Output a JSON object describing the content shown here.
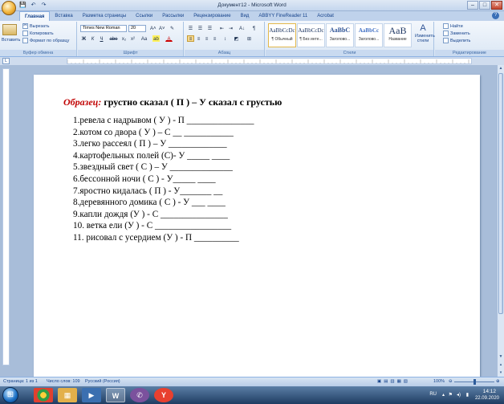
{
  "window": {
    "title": "Документ12 - Microsoft Word",
    "min": "–",
    "max": "□",
    "close": "✕"
  },
  "qat": {
    "save": "💾",
    "undo": "↶",
    "redo": "↷"
  },
  "tabs": [
    "Главная",
    "Вставка",
    "Разметка страницы",
    "Ссылки",
    "Рассылки",
    "Рецензирование",
    "Вид",
    "ABBYY FineReader 11",
    "Acrobat"
  ],
  "ribbon": {
    "clipboard": {
      "label": "Буфер обмена",
      "paste": "Вставить",
      "cut": "Вырезать",
      "copy": "Копировать",
      "format_painter": "Формат по образцу"
    },
    "font": {
      "label": "Шрифт",
      "font_name": "Times New Roman",
      "font_size": "20",
      "grow": "A˄",
      "shrink": "A˅",
      "clear": "✎",
      "bold": "Ж",
      "italic": "К",
      "underline": "Ч",
      "strike": "abe",
      "subscript": "x₂",
      "superscript": "x²",
      "case": "Aa",
      "highlight": "ab",
      "color": "A"
    },
    "paragraph": {
      "label": "Абзац",
      "bullets": "☰",
      "numbering": "☰",
      "multilevel": "☰",
      "dec_indent": "⇤",
      "inc_indent": "⇥",
      "sort": "A↓",
      "show_marks": "¶",
      "align_left": "≡",
      "align_center": "≡",
      "align_right": "≡",
      "justify": "≡",
      "spacing": "↕",
      "shading": "◩",
      "borders": "⊞"
    },
    "styles": {
      "label": "Стили",
      "items": [
        {
          "sample": "AaBbCcDc",
          "name": "¶ Обычный"
        },
        {
          "sample": "AaBbCcDc",
          "name": "¶ Без инте..."
        },
        {
          "sample": "AaBbC",
          "name": "Заголово..."
        },
        {
          "sample": "AaBbCc",
          "name": "Заголово..."
        },
        {
          "sample": "AaB",
          "name": "Название"
        }
      ],
      "change_styles": "Изменить стили"
    },
    "editing": {
      "label": "Редактирование",
      "find": "Найти",
      "replace": "Заменить",
      "select": "Выделить"
    }
  },
  "document": {
    "sample_label": "Образец:",
    "sample_text": " грустно сказал ( П   ) – У     сказал с грустью",
    "items": [
      "1.ревела с надрывом (  У  ) -  П _______________",
      "2.котом со двора ( У  ) – С __ ___________",
      "3.легко рассеял (  П  ) – У  _____________",
      "4.картофельных полей  (С)- У  _____ ____",
      "5.звездный свет ( С  ) – У  ______________",
      "6.бессонной ночи ( С   )  -  У_____ ____",
      "7.яростно кидалась ( П   ) -  У_______ __",
      "8.деревянного домика ( С   ) -  У ___ ____",
      "9.капли дождя  (У    ) -  С _______________",
      "10.      ветка ели (У    ) -  С _________________",
      "11.      рисовал с усердием  (У   ) -  П __________"
    ]
  },
  "statusbar": {
    "page": "Страница: 1 из 1",
    "words": "Число слов: 109",
    "language": "Русский (Россия)",
    "zoom": "100%"
  },
  "taskbar": {
    "start": "⊞",
    "apps": [
      {
        "name": "chrome",
        "icon": "◉"
      },
      {
        "name": "explorer",
        "icon": "▦"
      },
      {
        "name": "media",
        "icon": "▶"
      },
      {
        "name": "word",
        "icon": "W"
      },
      {
        "name": "viber",
        "icon": "✆"
      },
      {
        "name": "yandex",
        "icon": "Y"
      }
    ],
    "language": "RU",
    "time": "14:12",
    "date": "22.09.2020"
  }
}
